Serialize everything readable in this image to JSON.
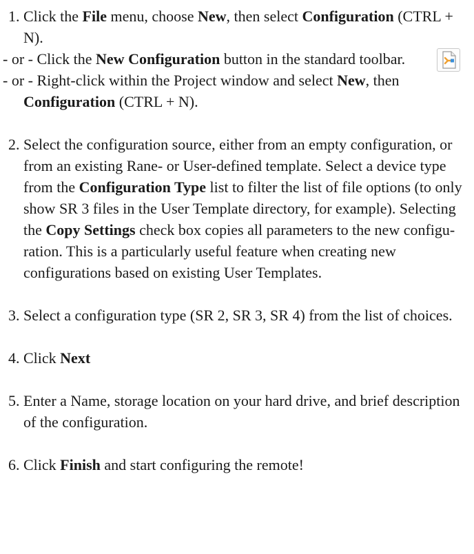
{
  "steps": {
    "s1": {
      "num": "1. ",
      "a": "Click the ",
      "b": "File",
      "c": " menu, choose ",
      "d": "New",
      "e": ", then select ",
      "f": "Configuration",
      "g": " (CTRL + N)."
    },
    "alt1": {
      "a": "- or - Click the ",
      "b": "New Configuration",
      "c": " button in the standard toolbar.",
      "icon": "new-configuration-icon"
    },
    "alt2": {
      "a": "- or - Right-click within the Project window and select ",
      "b": "New",
      "c": ", then ",
      "d": "Configuration",
      "e": " (CTRL + N)."
    },
    "s2": {
      "num": "2. ",
      "a": "Select the configuration source, either from an empty configuration, or from an existing Rane- or User-defined template. Select a device type from the ",
      "b": "Configuration Type",
      "c": " list to filter the list of file options (to only show SR 3 files in the User Template directory, for example). Selecting the ",
      "d": "Copy Settings",
      "e": " check box copies all parameters to the new configu­ration. This is a particularly useful feature when creating new configurations based on existing User Templates."
    },
    "s3": {
      "num": "3. ",
      "a": "Select a configuration type (SR 2, SR 3, SR 4) from the list of choices."
    },
    "s4": {
      "num": "4. ",
      "a": "Click ",
      "b": "Next"
    },
    "s5": {
      "num": "5. ",
      "a": "Enter a Name, storage location on your hard drive, and brief description of the configuration."
    },
    "s6": {
      "num": "6. ",
      "a": "Click ",
      "b": "Finish",
      "c": " and start configuring the remote!"
    }
  },
  "colors": {
    "text": "#1a1a1a",
    "icon_orange": "#f0a030",
    "icon_blue": "#3a8fd8"
  }
}
